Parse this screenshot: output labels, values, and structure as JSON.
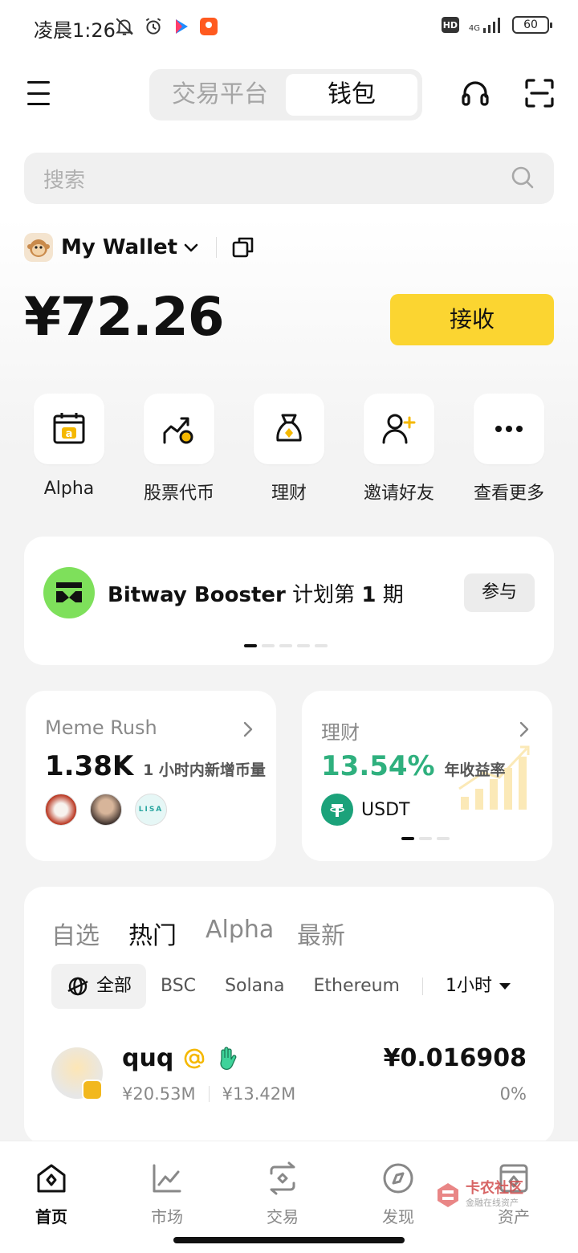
{
  "status_bar": {
    "time": "凌晨1:26",
    "hd": "HD",
    "network": "4G",
    "battery": "60"
  },
  "header": {
    "tabs": [
      {
        "label": "交易平台",
        "active": false
      },
      {
        "label": "钱包",
        "active": true
      }
    ]
  },
  "search": {
    "placeholder": "搜索"
  },
  "wallet": {
    "name": "My Wallet",
    "balance": "¥72.26",
    "receive_label": "接收"
  },
  "shortcuts": [
    {
      "label": "Alpha"
    },
    {
      "label": "股票代币"
    },
    {
      "label": "理财"
    },
    {
      "label": "邀请好友"
    },
    {
      "label": "查看更多"
    }
  ],
  "banner": {
    "brand": "Bitway Booster",
    "plan": "计划第",
    "number": "1",
    "unit": "期",
    "button": "参与",
    "pages": 5,
    "active_page": 1
  },
  "meme_card": {
    "title": "Meme Rush",
    "value": "1.38K",
    "subtitle": "1 小时内新增币量",
    "avatar_badge": "LISA"
  },
  "earn_card": {
    "title": "理财",
    "value": "13.54%",
    "subtitle": "年收益率",
    "asset": "USDT",
    "pages": 3,
    "active_page": 1
  },
  "market": {
    "tabs": [
      {
        "label": "自选",
        "active": false
      },
      {
        "label": "热门",
        "active": true
      },
      {
        "label": "Alpha",
        "active": false
      },
      {
        "label": "最新",
        "active": false
      }
    ],
    "chains": [
      {
        "label": "全部",
        "active": true
      },
      {
        "label": "BSC",
        "active": false
      },
      {
        "label": "Solana",
        "active": false
      },
      {
        "label": "Ethereum",
        "active": false
      }
    ],
    "timeframe": "1小时",
    "rows": [
      {
        "name": "quq",
        "volume": "¥20.53M",
        "liquidity": "¥13.42M",
        "price": "¥0.016908",
        "change": "0%"
      }
    ]
  },
  "bottom_nav": [
    {
      "label": "首页",
      "active": true
    },
    {
      "label": "市场",
      "active": false
    },
    {
      "label": "交易",
      "active": false
    },
    {
      "label": "发现",
      "active": false
    },
    {
      "label": "资产",
      "active": false
    }
  ],
  "watermark": {
    "title": "卡农社区",
    "subtitle": "金融在线资产"
  },
  "colors": {
    "accent_yellow": "#fbd531",
    "positive_green": "#2fb07e",
    "booster_green": "#7ee05b"
  }
}
